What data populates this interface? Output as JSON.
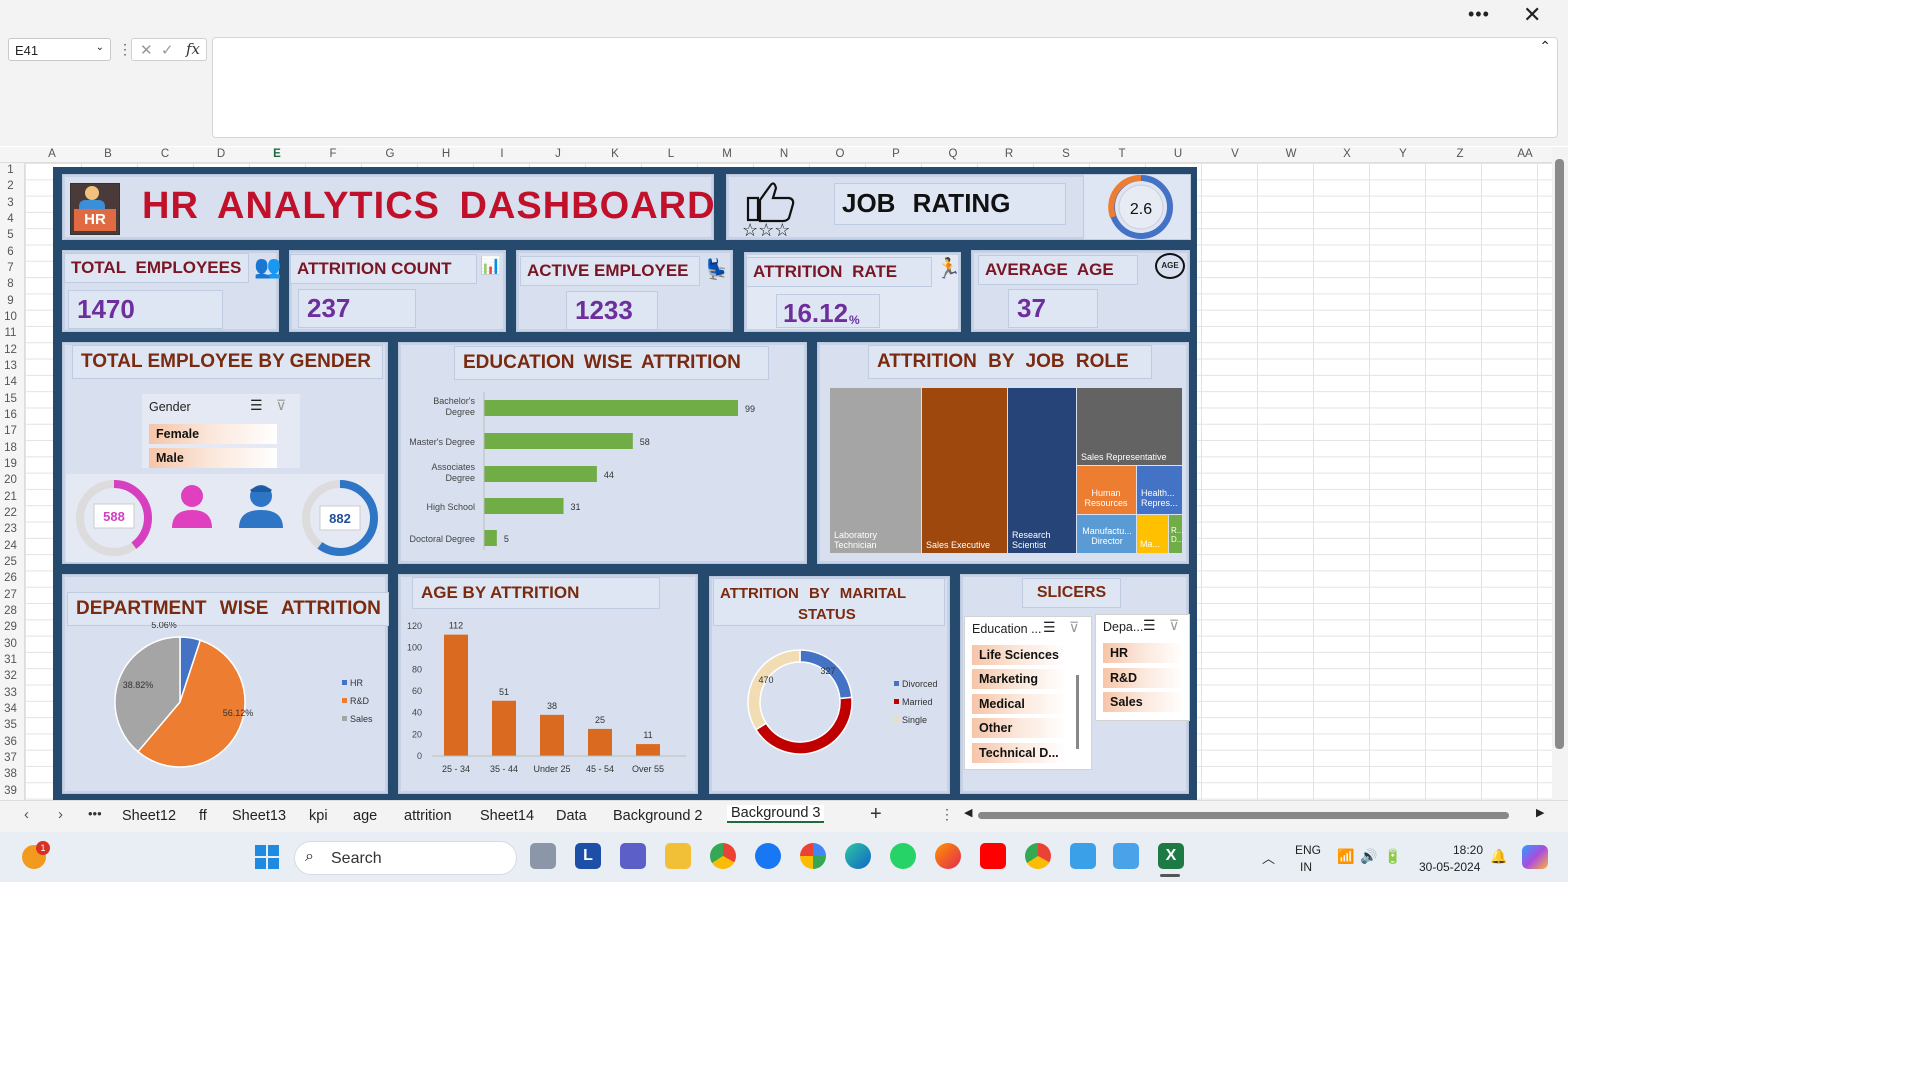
{
  "formula_bar": {
    "cell": "E41"
  },
  "columns": [
    "A",
    "B",
    "C",
    "D",
    "E",
    "F",
    "G",
    "H",
    "I",
    "J",
    "K",
    "L",
    "M",
    "N",
    "O",
    "P",
    "Q",
    "R",
    "S",
    "T",
    "U",
    "V",
    "W",
    "X",
    "Y",
    "Z",
    "AA"
  ],
  "rows": [
    "1",
    "2",
    "3",
    "4",
    "5",
    "6",
    "7",
    "8",
    "9",
    "10",
    "11",
    "12",
    "13",
    "14",
    "15",
    "16",
    "17",
    "18",
    "19",
    "20",
    "21",
    "22",
    "23",
    "24",
    "25",
    "26",
    "27",
    "28",
    "29",
    "30",
    "31",
    "32",
    "33",
    "34",
    "35",
    "36",
    "37",
    "38",
    "39"
  ],
  "dashboard": {
    "title": "HR ANALYTICS DASHBOARD",
    "job_rating_label": "JOB RATING",
    "job_rating_value": "2.6",
    "logo_text": "HR",
    "kpis": {
      "total_employees": {
        "label": "TOTAL EMPLOYEES",
        "value": "1470"
      },
      "attrition_count": {
        "label": "ATTRITION COUNT",
        "value": "237"
      },
      "active_employee": {
        "label": "ACTIVE EMPLOYEE",
        "value": "1233"
      },
      "attrition_rate": {
        "label": "ATTRITION RATE",
        "value": "16.12",
        "unit": "%"
      },
      "average_age": {
        "label": "AVERAGE AGE",
        "value": "37",
        "badge": "AGE"
      }
    },
    "gender": {
      "title": "TOTAL EMPLOYEE BY GENDER",
      "slicer_title": "Gender",
      "options": [
        "Female",
        "Male"
      ],
      "female_value": "588",
      "male_value": "882",
      "female_fraction": 0.4,
      "male_fraction": 0.6
    },
    "education_title": "EDUCATION WISE ATTRITION",
    "job_role_title": "ATTRITION BY JOB ROLE",
    "job_roles": {
      "lab": "Laboratory Technician",
      "sales_exec": "Sales Executive",
      "research": "Research Scientist",
      "sales_rep": "Sales Representative",
      "hr": "Human Resources",
      "health": "Health... Repres...",
      "manufacturing": "Manufactu... Director",
      "manager": "Ma...",
      "rd": "R... D..."
    },
    "department_title": "DEPARTMENT WISE ATTRITION",
    "age_title": "AGE BY ATTRITION",
    "marital_title_1": "ATTRITION BY MARITAL",
    "marital_title_2": "STATUS",
    "slicers_title": "SLICERS",
    "education_slicer": {
      "title": "Education ...",
      "items": [
        "Life Sciences",
        "Marketing",
        "Medical",
        "Other",
        "Technical D..."
      ]
    },
    "department_slicer": {
      "title": "Depa...",
      "items": [
        "HR",
        "R&D",
        "Sales"
      ]
    }
  },
  "chart_data": [
    {
      "type": "bar",
      "orientation": "horizontal",
      "title": "EDUCATION WISE ATTRITION",
      "categories": [
        "Bachelor's Degree",
        "Master's Degree",
        "Associates Degree",
        "High School",
        "Doctoral Degree"
      ],
      "values": [
        99,
        58,
        44,
        31,
        5
      ],
      "color": "#70ad47"
    },
    {
      "type": "bar",
      "title": "AGE BY ATTRITION",
      "categories": [
        "25 - 34",
        "35 - 44",
        "Under 25",
        "45 - 54",
        "Over 55"
      ],
      "values": [
        112,
        51,
        38,
        25,
        11
      ],
      "ylim": [
        0,
        120
      ],
      "yticks": [
        0,
        20,
        40,
        60,
        80,
        100,
        120
      ],
      "color": "#d96a1f"
    },
    {
      "type": "pie",
      "title": "DEPARTMENT WISE ATTRITION",
      "categories": [
        "HR",
        "R&D",
        "Sales"
      ],
      "values": [
        5.06,
        56.12,
        38.82
      ],
      "labels": [
        "5.06%",
        "56.12%",
        "38.82%"
      ],
      "colors": [
        "#4472c4",
        "#ed7d31",
        "#a5a5a5"
      ],
      "legend": "right"
    },
    {
      "type": "pie",
      "variant": "donut",
      "title": "ATTRITION BY MARITAL STATUS",
      "categories": [
        "Divorced",
        "Married",
        "Single"
      ],
      "values": [
        327,
        589,
        470
      ],
      "labels": [
        "327",
        "",
        "470"
      ],
      "colors": [
        "#4472c4",
        "#c00000",
        "#f2dcb3"
      ],
      "legend": "right"
    },
    {
      "type": "treemap",
      "title": "ATTRITION BY JOB ROLE",
      "categories": [
        "Laboratory Technician",
        "Sales Executive",
        "Research Scientist",
        "Sales Representative",
        "Human Resources",
        "Healthcare Representative",
        "Manufacturing Director",
        "Manager",
        "Research Director"
      ]
    }
  ],
  "sheet_tabs": [
    "Sheet12",
    "ff",
    "Sheet13",
    "kpi",
    "age",
    "attrition",
    "Sheet14",
    "Data",
    "Background 2",
    "Background 3"
  ],
  "active_tab": "Background 3",
  "taskbar": {
    "search": "Search",
    "lang1": "ENG",
    "lang2": "IN",
    "time": "18:20",
    "date": "30-05-2024",
    "notif_badge": "1"
  }
}
